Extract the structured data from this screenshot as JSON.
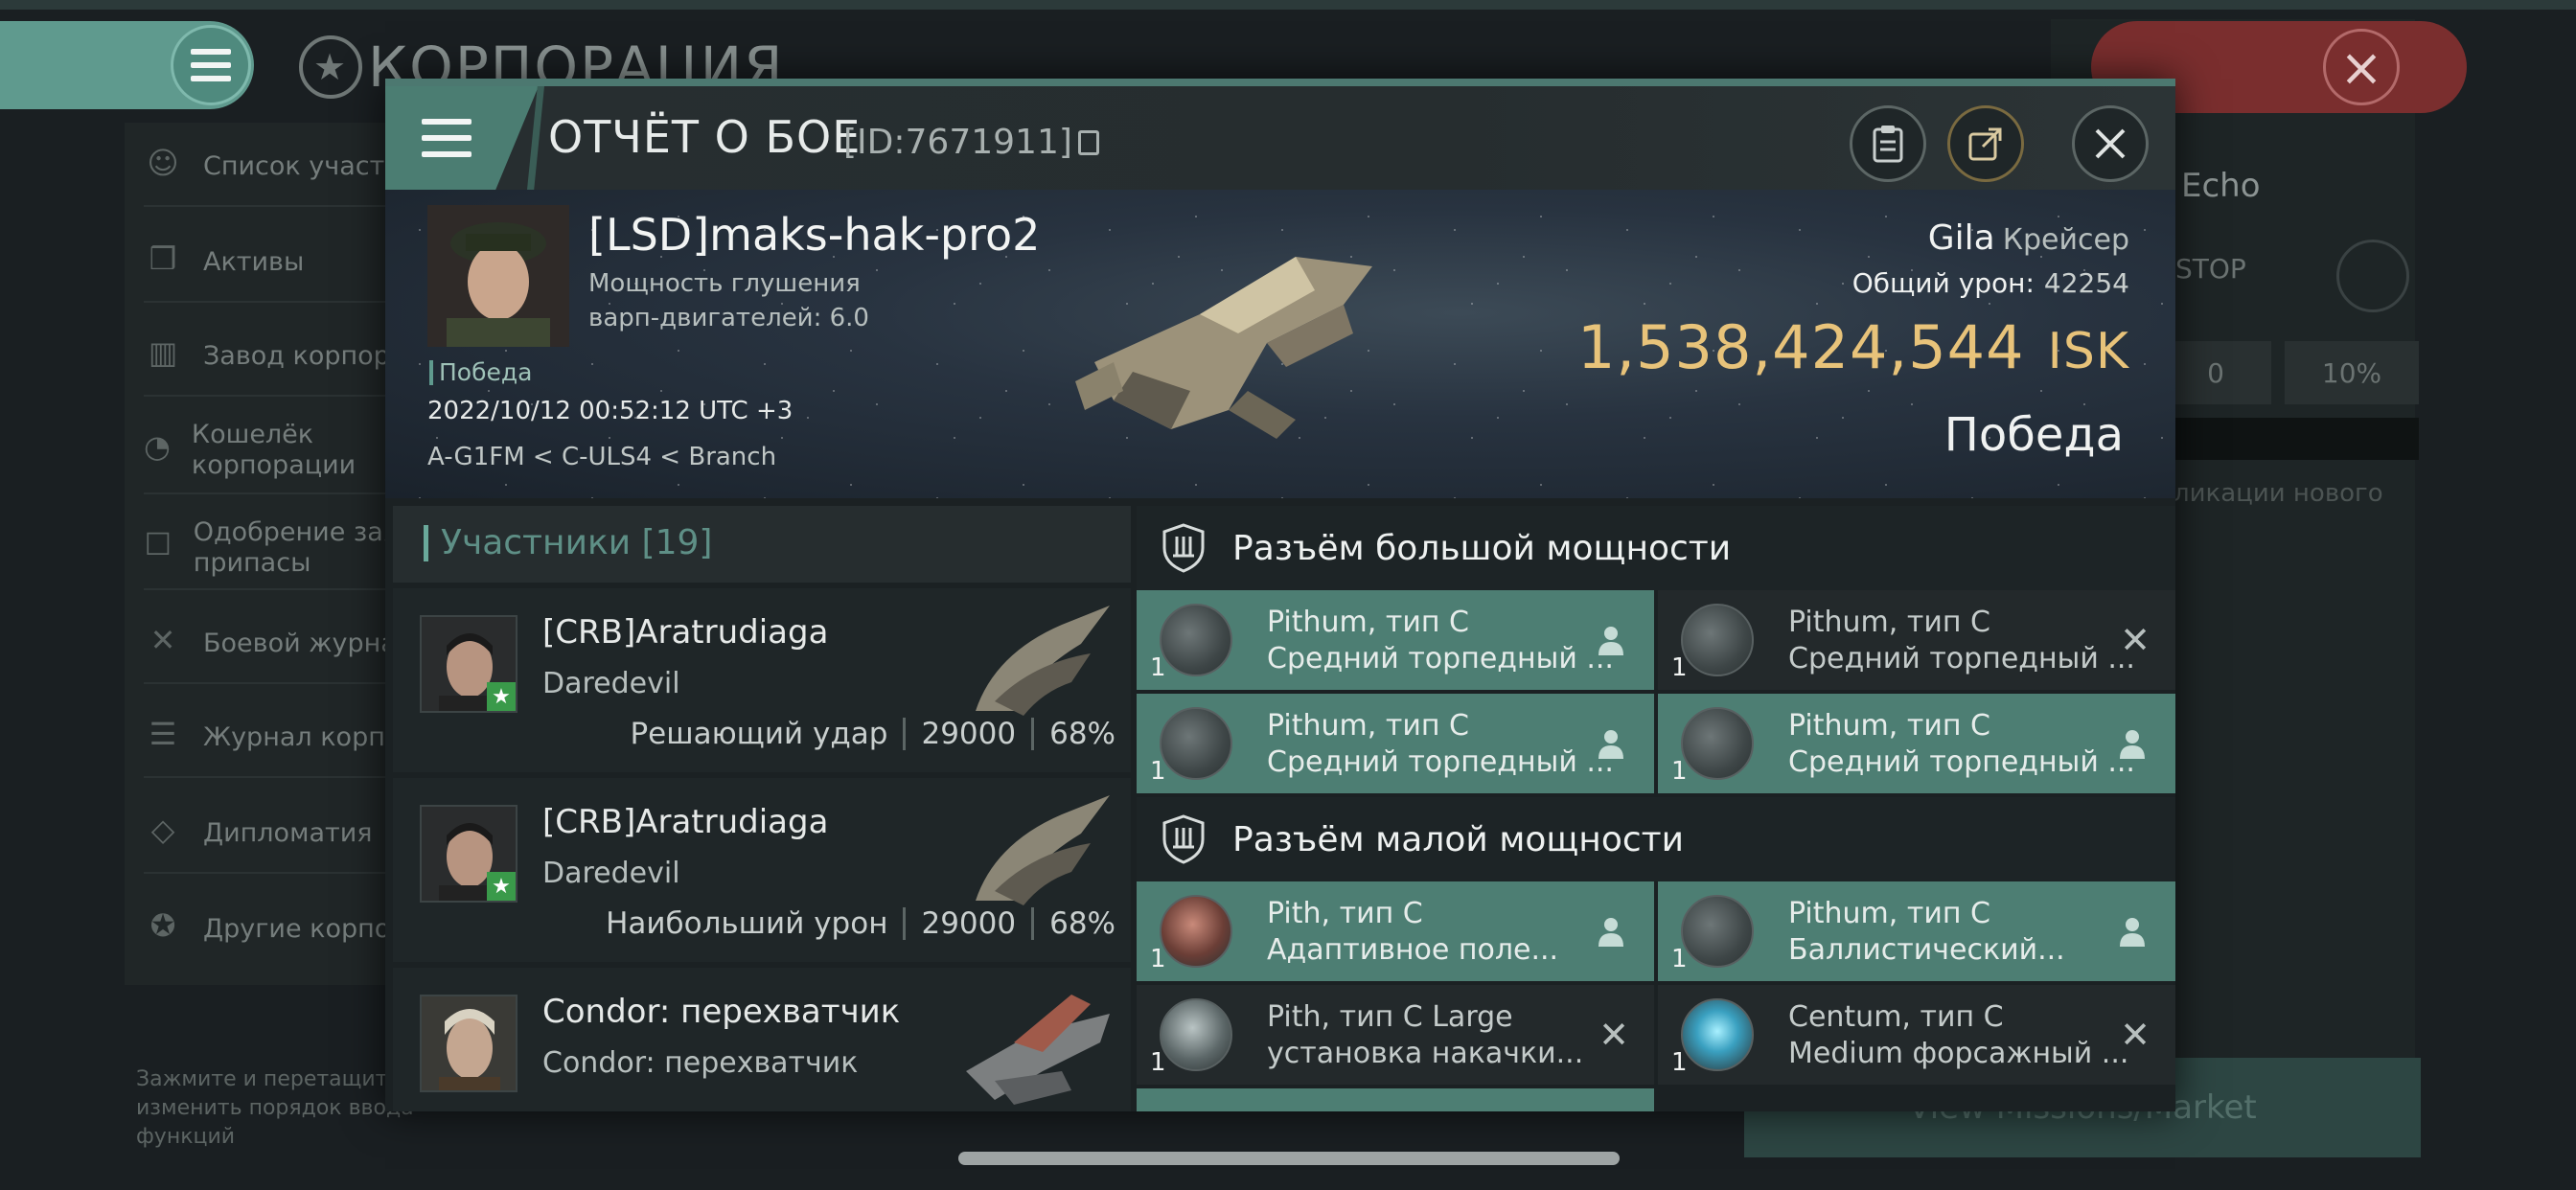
{
  "background": {
    "title": "КОРПОРАЦИЯ",
    "menu_items": [
      {
        "label": "Список участни",
        "icon": "members-icon"
      },
      {
        "label": "Активы",
        "icon": "assets-icon"
      },
      {
        "label": "Завод корпора",
        "icon": "factory-icon"
      },
      {
        "label": "Кошелёк корпорации",
        "icon": "wallet-icon"
      },
      {
        "label": "Одобрение зая на припасы",
        "icon": "approval-icon"
      },
      {
        "label": "Боевой журнал",
        "icon": "combat-log-icon"
      },
      {
        "label": "Журнал корпор",
        "icon": "journal-icon"
      },
      {
        "label": "Дипломатия",
        "icon": "diplomacy-icon"
      },
      {
        "label": "Другие корпор",
        "icon": "star-icon"
      }
    ],
    "hint": "Зажмите и перетащите изменить порядок ввода функций",
    "right": {
      "echo": "Echo",
      "stop": "STOP",
      "cell_a": "0",
      "cell_b": "10%",
      "new_hint": "ликации нового",
      "market": "View Missions/Market"
    }
  },
  "modal": {
    "title": "ОТЧЁТ О БОЕ",
    "id_text": "[ID:7671911]",
    "pilot": {
      "name": "[LSD]maks-hak-pro2",
      "sub": "Мощность глушения варп-двигателей: 6.0",
      "result": "Победа",
      "datetime": "2022/10/12 00:52:12 UTC +3",
      "location": "A-G1FM < C-ULS4 < Branch"
    },
    "ship": {
      "name": "Gila",
      "class": "Крейсер",
      "damage_label": "Общий урон:",
      "damage_value": "42254",
      "isk_value": "1,538,424,544",
      "isk_unit": "ISK",
      "outcome": "Победа"
    },
    "participants": {
      "title": "Участники [19]",
      "rows": [
        {
          "name": "[CRB]Aratrudiaga",
          "ship": "Daredevil",
          "tag": "Решающий удар",
          "damage": "29000",
          "percent": "68%"
        },
        {
          "name": "[CRB]Aratrudiaga",
          "ship": "Daredevil",
          "tag": "Наибольший урон",
          "damage": "29000",
          "percent": "68%"
        },
        {
          "name": "Condor: перехватчик",
          "ship": "Condor: перехватчик",
          "tag": "",
          "damage": "",
          "percent": ""
        }
      ]
    },
    "fittings": {
      "high_title": "Разъём большой мощности",
      "low_title": "Разъём малой мощности",
      "high": [
        {
          "name": "Pithum, тип C",
          "desc": "Средний торпедный ...",
          "qty": "1",
          "state": "pilot"
        },
        {
          "name": "Pithum, тип C",
          "desc": "Средний торпедный ...",
          "qty": "1",
          "state": "destroyed"
        },
        {
          "name": "Pithum, тип C",
          "desc": "Средний торпедный ...",
          "qty": "1",
          "state": "pilot"
        },
        {
          "name": "Pithum, тип C",
          "desc": "Средний торпедный ...",
          "qty": "1",
          "state": "pilot"
        }
      ],
      "low": [
        {
          "name": "Pith, тип C",
          "desc": "Адаптивное поле...",
          "qty": "1",
          "state": "pilot"
        },
        {
          "name": "Pithum, тип C",
          "desc": "Баллистический...",
          "qty": "1",
          "state": "pilot"
        },
        {
          "name": "Pith, тип C Large",
          "desc": "установка накачки...",
          "qty": "1",
          "state": "destroyed"
        },
        {
          "name": "Centum, тип C",
          "desc": "Medium форсажный ...",
          "qty": "1",
          "state": "destroyed"
        }
      ]
    }
  }
}
